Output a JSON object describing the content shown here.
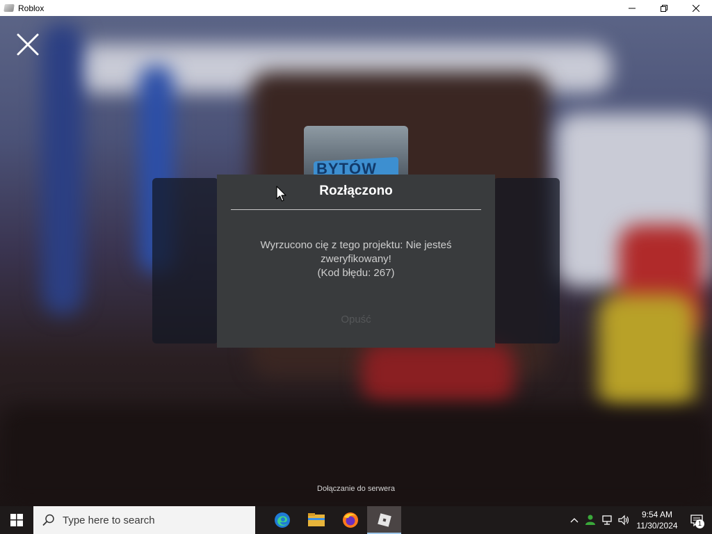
{
  "window": {
    "title": "Roblox"
  },
  "game": {
    "thumbnail_text": "BYTÓW",
    "status_text": "Dołączanie do serwera"
  },
  "dialog": {
    "title": "Rozłączono",
    "message_line1": "Wyrzucono cię z tego projektu: Nie jesteś",
    "message_line2": "zweryfikowany!",
    "message_line3": "(Kod błędu: 267)",
    "leave_label": "Opuść"
  },
  "taskbar": {
    "search_placeholder": "Type here to search",
    "apps": [
      "edge-icon",
      "file-explorer-icon",
      "firefox-icon",
      "roblox-icon"
    ],
    "clock_time": "9:54 AM",
    "clock_date": "11/30/2024",
    "notification_count": "1"
  },
  "colors": {
    "dialog_bg": "#393b3d",
    "taskbar_bg": "#1e1a1a",
    "accent": "#9fc7ea"
  }
}
